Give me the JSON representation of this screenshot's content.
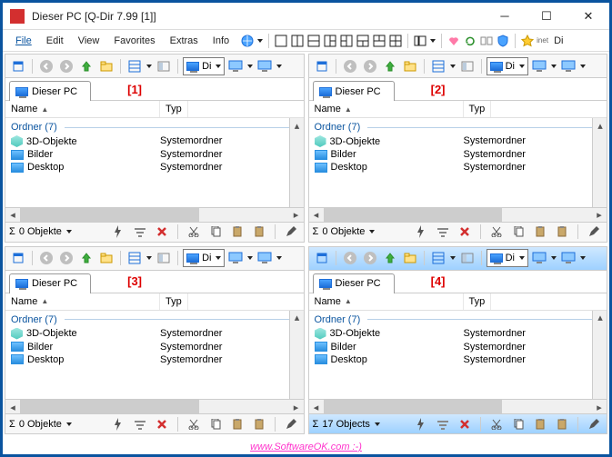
{
  "window": {
    "title": "Dieser PC  [Q-Dir 7.99 [1]]"
  },
  "menu": {
    "file": "File",
    "edit": "Edit",
    "view": "View",
    "favorites": "Favorites",
    "extras": "Extras",
    "info": "Info",
    "inet": "inet",
    "di": "Di"
  },
  "panes": [
    {
      "annot": "[1]",
      "tab": "Dieser PC",
      "dropdown": "Di",
      "cols": {
        "name": "Name",
        "type": "Typ"
      },
      "group": "Ordner (7)",
      "rows": [
        {
          "icon": "cube",
          "name": "3D-Objekte",
          "type": "Systemordner"
        },
        {
          "icon": "folder",
          "name": "Bilder",
          "type": "Systemordner"
        },
        {
          "icon": "folder",
          "name": "Desktop",
          "type": "Systemordner"
        }
      ],
      "status": "0 Objekte",
      "active": false
    },
    {
      "annot": "[2]",
      "tab": "Dieser PC",
      "dropdown": "Di",
      "cols": {
        "name": "Name",
        "type": "Typ"
      },
      "group": "Ordner (7)",
      "rows": [
        {
          "icon": "cube",
          "name": "3D-Objekte",
          "type": "Systemordner"
        },
        {
          "icon": "folder",
          "name": "Bilder",
          "type": "Systemordner"
        },
        {
          "icon": "folder",
          "name": "Desktop",
          "type": "Systemordner"
        }
      ],
      "status": "0 Objekte",
      "active": false
    },
    {
      "annot": "[3]",
      "tab": "Dieser PC",
      "dropdown": "Di",
      "cols": {
        "name": "Name",
        "type": "Typ"
      },
      "group": "Ordner (7)",
      "rows": [
        {
          "icon": "cube",
          "name": "3D-Objekte",
          "type": "Systemordner"
        },
        {
          "icon": "folder",
          "name": "Bilder",
          "type": "Systemordner"
        },
        {
          "icon": "folder",
          "name": "Desktop",
          "type": "Systemordner"
        }
      ],
      "status": "0 Objekte",
      "active": false
    },
    {
      "annot": "[4]",
      "tab": "Dieser PC",
      "dropdown": "Di",
      "cols": {
        "name": "Name",
        "type": "Typ"
      },
      "group": "Ordner (7)",
      "rows": [
        {
          "icon": "cube",
          "name": "3D-Objekte",
          "type": "Systemordner"
        },
        {
          "icon": "folder",
          "name": "Bilder",
          "type": "Systemordner"
        },
        {
          "icon": "folder",
          "name": "Desktop",
          "type": "Systemordner"
        }
      ],
      "status": "17 Objects",
      "active": true
    }
  ],
  "watermark": "www.SoftwareOK.com :-)"
}
